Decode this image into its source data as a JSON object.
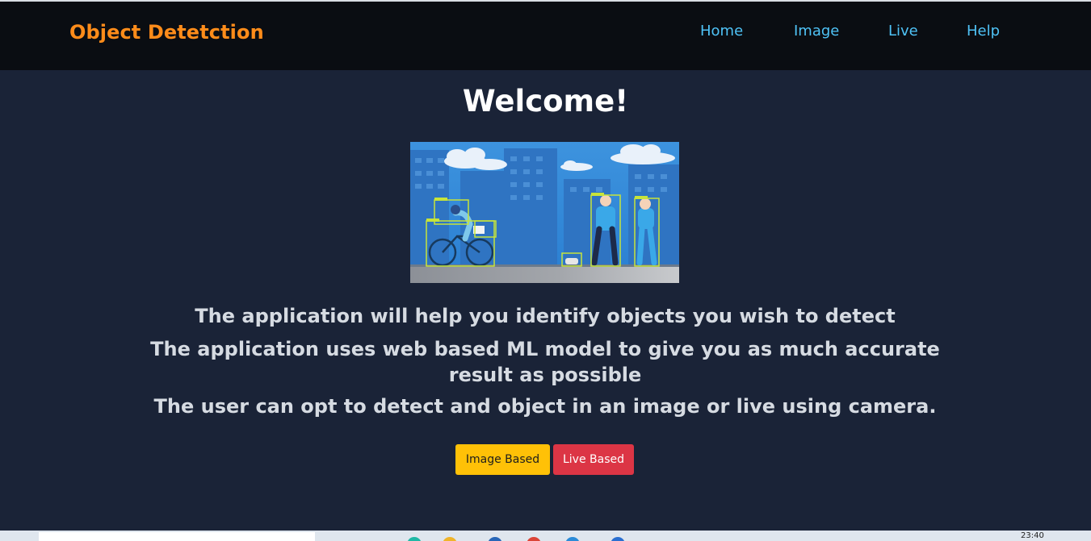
{
  "nav": {
    "brand": "Object Detetction",
    "links": [
      "Home",
      "Image",
      "Live",
      "Help"
    ]
  },
  "main": {
    "title": "Welcome!",
    "hero_image": {
      "alt": "Illustration of object detection in a city street"
    },
    "descriptions": [
      "The application will help you identify objects you wish to detect",
      "The application uses web based ML model to give you as much accurate result as possible",
      "The user can opt to detect and object in an image or live using camera."
    ],
    "buttons": {
      "image_based": "Image Based",
      "live_based": "Live Based"
    }
  },
  "taskbar": {
    "time": "23:40"
  },
  "colors": {
    "page_background": "#1a2337",
    "navbar_background": "#0a0d12",
    "brand": "#ff8c1a",
    "nav_link": "#4fc3f7",
    "image_button": "#ffc107",
    "live_button": "#dc3545"
  }
}
